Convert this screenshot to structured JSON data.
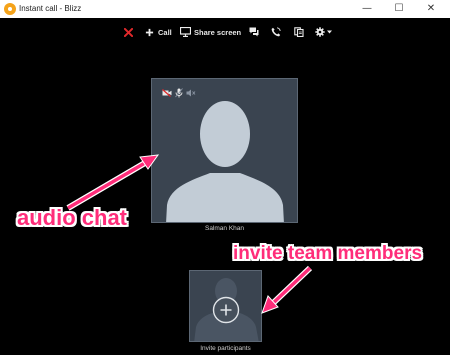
{
  "window": {
    "title": "Instant call - Blizz",
    "controls": {
      "minimize": "—",
      "maximize": "☐",
      "close": "✕"
    }
  },
  "toolbar": {
    "end_call_icon": "end-call-x-icon",
    "call_label": "Call",
    "share_label": "Share screen",
    "items": [
      "end-call-icon",
      "add-call-icon",
      "share-screen-icon",
      "chat-icon",
      "phone-icon",
      "documents-icon",
      "settings-icon"
    ]
  },
  "participant": {
    "name": "Salman Khan",
    "media_icons": [
      "video-off-icon",
      "mic-icon",
      "speaker-icon"
    ]
  },
  "invite": {
    "label": "Invite participants",
    "icon": "plus-circle-icon"
  },
  "annotations": {
    "audio": "audio chat",
    "invite": "invite team members"
  },
  "colors": {
    "annotation": "#ff2d7a",
    "tile_background": "#3a4450",
    "avatar": "#c2ccd6",
    "end_call": "#e0292b",
    "app_icon": "#f5a31a"
  }
}
